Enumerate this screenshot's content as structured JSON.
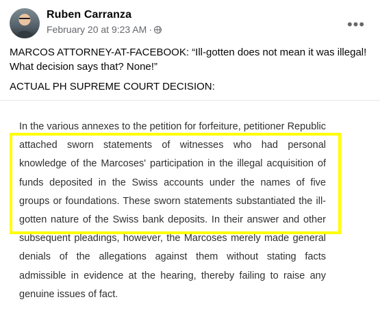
{
  "post": {
    "author": "Ruben Carranza",
    "timestamp": "February 20 at 9:23 AM",
    "separator": "·",
    "privacy_icon": "globe-icon",
    "more_icon": "more-options-icon",
    "text_line1": "MARCOS ATTORNEY-AT-FACEBOOK: “Ill-gotten does not mean it was illegal! What decision says that? None!”",
    "text_line2": "ACTUAL PH SUPREME COURT DECISION:"
  },
  "court_excerpt": {
    "text": "In the various annexes to the petition for forfeiture, petitioner Republic attached sworn statements of witnesses who had personal knowledge of the Marcoses' participation in the illegal acquisition of funds deposited in the Swiss accounts under the names of five groups or foundations. These sworn statements substantiated the ill-gotten nature of the Swiss bank deposits. In their answer and other subsequent pleadings, however, the Marcoses merely made general denials of the allegations against them without stating facts admissible in evidence at the hearing, thereby failing to raise any genuine issues of fact.",
    "highlight_color": "#ffff00"
  }
}
